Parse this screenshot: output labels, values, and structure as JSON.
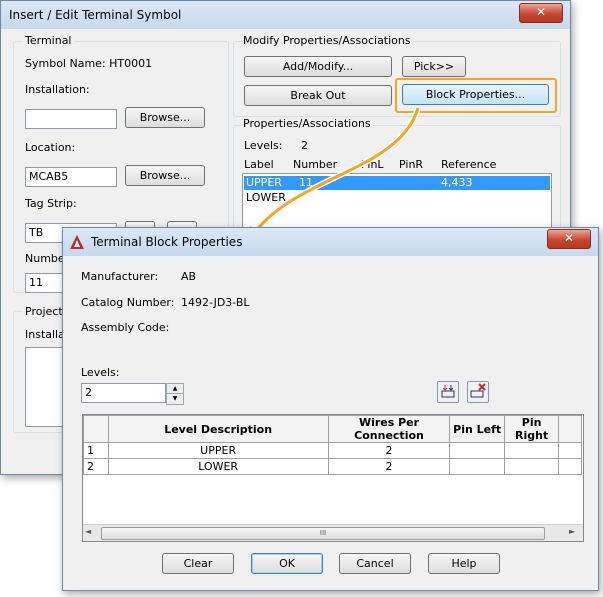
{
  "back": {
    "title": "Insert / Edit Terminal Symbol",
    "close_glyph": "✕",
    "terminal_group": "Terminal",
    "symbol_name": "Symbol Name: HT0001",
    "installation_label": "Installation:",
    "installation_value": "",
    "browse1": "Browse...",
    "location_label": "Location:",
    "location_value": "MCAB5",
    "browse2": "Browse...",
    "tagstrip_label": "Tag Strip:",
    "tagstrip_value": "TB",
    "number_label": "Number",
    "number_value": "11",
    "project_group": "Project",
    "project_install_label": "Installati",
    "modify_group": "Modify Properties/Associations",
    "add_modify": "Add/Modify...",
    "pick": "Pick>>",
    "break_out": "Break Out",
    "block_properties": "Block Properties...",
    "props_group": "Properties/Associations",
    "levels_label": "Levels:",
    "levels_value": "2",
    "headers": [
      "Label",
      "Number",
      "PinL",
      "PinR",
      "Reference"
    ],
    "rows": [
      {
        "label": "UPPER",
        "number": "11",
        "pinl": "",
        "pinr": "",
        "reference": "4,433"
      },
      {
        "label": "LOWER",
        "number": "",
        "pinl": "",
        "pinr": "",
        "reference": ""
      }
    ]
  },
  "front": {
    "title": "Terminal Block Properties",
    "close_glyph": "✕",
    "manufacturer_label": "Manufacturer:",
    "manufacturer_value": "AB",
    "catalog_label": "Catalog Number:",
    "catalog_value": "1492-JD3-BL",
    "assembly_label": "Assembly Code:",
    "assembly_value": "",
    "levels_label": "Levels:",
    "levels_value": "2",
    "columns": [
      "",
      "Level Description",
      "Wires Per Connection",
      "Pin Left",
      "Pin Right"
    ],
    "rows": [
      {
        "num": "1",
        "desc": "UPPER",
        "wires": "2",
        "pinl": "",
        "pinr": ""
      },
      {
        "num": "2",
        "desc": "LOWER",
        "wires": "2",
        "pinl": "",
        "pinr": ""
      }
    ],
    "scroll_thumb": "III",
    "clear": "Clear",
    "ok": "OK",
    "cancel": "Cancel",
    "help": "Help"
  },
  "colors": {
    "accent_arrow": "#f5a623",
    "selection": "#3399ff"
  }
}
